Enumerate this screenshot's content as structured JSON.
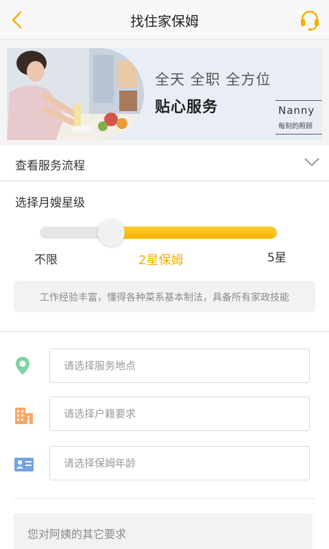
{
  "header": {
    "title": "找住家保姆",
    "accent": "#f6ad00"
  },
  "banner": {
    "line1": "全天 全职 全方位",
    "line2": "贴心服务",
    "brand_name": "Nanny",
    "brand_sub": "每刻的照顾"
  },
  "process": {
    "label": "查看服务流程"
  },
  "star": {
    "label": "选择月嫂星级",
    "min_label": "不限",
    "current_label": "2星保姆",
    "max_label": "5星",
    "level_fraction": 0.3,
    "description": "工作经验丰富，懂得各种菜系基本制法，具备所有家政技能"
  },
  "form": {
    "location_placeholder": "请选择服务地点",
    "hukou_placeholder": "请选择户籍要求",
    "age_placeholder": "请选择保姆年龄",
    "other_placeholder": "您对阿姨的其它要求"
  }
}
